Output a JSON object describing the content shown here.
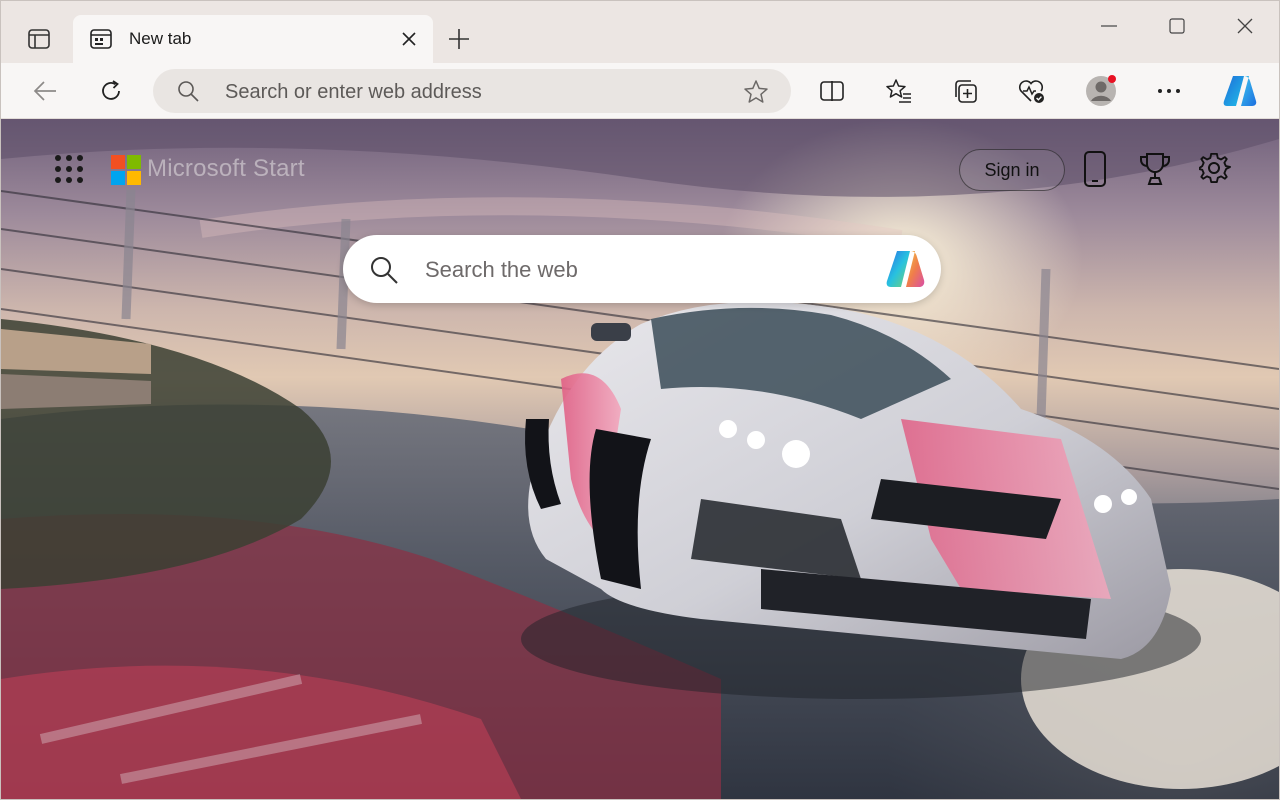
{
  "tab": {
    "title": "New tab",
    "close_label": "Close tab"
  },
  "toolbar": {
    "address_placeholder": "Search or enter web address"
  },
  "newtab": {
    "brand": "Microsoft Start",
    "signin_label": "Sign in",
    "search_placeholder": "Search the web"
  },
  "colors": {
    "ms_red": "#f25022",
    "ms_green": "#7fba00",
    "ms_blue": "#00a4ef",
    "ms_yellow": "#ffb900",
    "profile_badge": "#e81123"
  },
  "icons": [
    "sidebar-toggle-icon",
    "tab-favicon-icon",
    "close-icon",
    "plus-icon",
    "minimize-icon",
    "maximize-icon",
    "window-close-icon",
    "back-arrow-icon",
    "refresh-icon",
    "search-icon",
    "star-icon",
    "split-screen-icon",
    "favorites-icon",
    "collections-icon",
    "browser-essentials-icon",
    "profile-icon",
    "more-icon",
    "copilot-icon",
    "apps-grid-icon",
    "microsoft-logo",
    "phone-icon",
    "rewards-trophy-icon",
    "settings-gear-icon"
  ]
}
